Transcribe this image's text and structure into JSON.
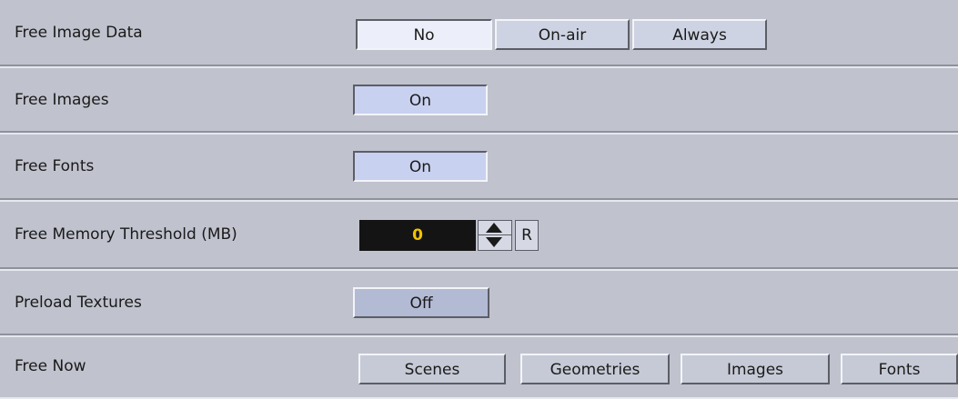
{
  "rows": {
    "free_image_data": {
      "label": "Free Image Data",
      "options": [
        "No",
        "On-air",
        "Always"
      ],
      "selected": "No"
    },
    "free_images": {
      "label": "Free Images",
      "value": "On"
    },
    "free_fonts": {
      "label": "Free Fonts",
      "value": "On"
    },
    "free_memory_threshold": {
      "label": "Free Memory Threshold (MB)",
      "value": "0",
      "reset_label": "R"
    },
    "preload_textures": {
      "label": "Preload Textures",
      "value": "Off"
    },
    "free_now": {
      "label": "Free Now",
      "buttons": [
        "Scenes",
        "Geometries",
        "Images",
        "Fonts"
      ]
    }
  },
  "colors": {
    "background": "#c0c3ce",
    "numeric_field_bg": "#141414",
    "numeric_field_text": "#f2c400",
    "toggle_on": "#c9d1f0"
  }
}
